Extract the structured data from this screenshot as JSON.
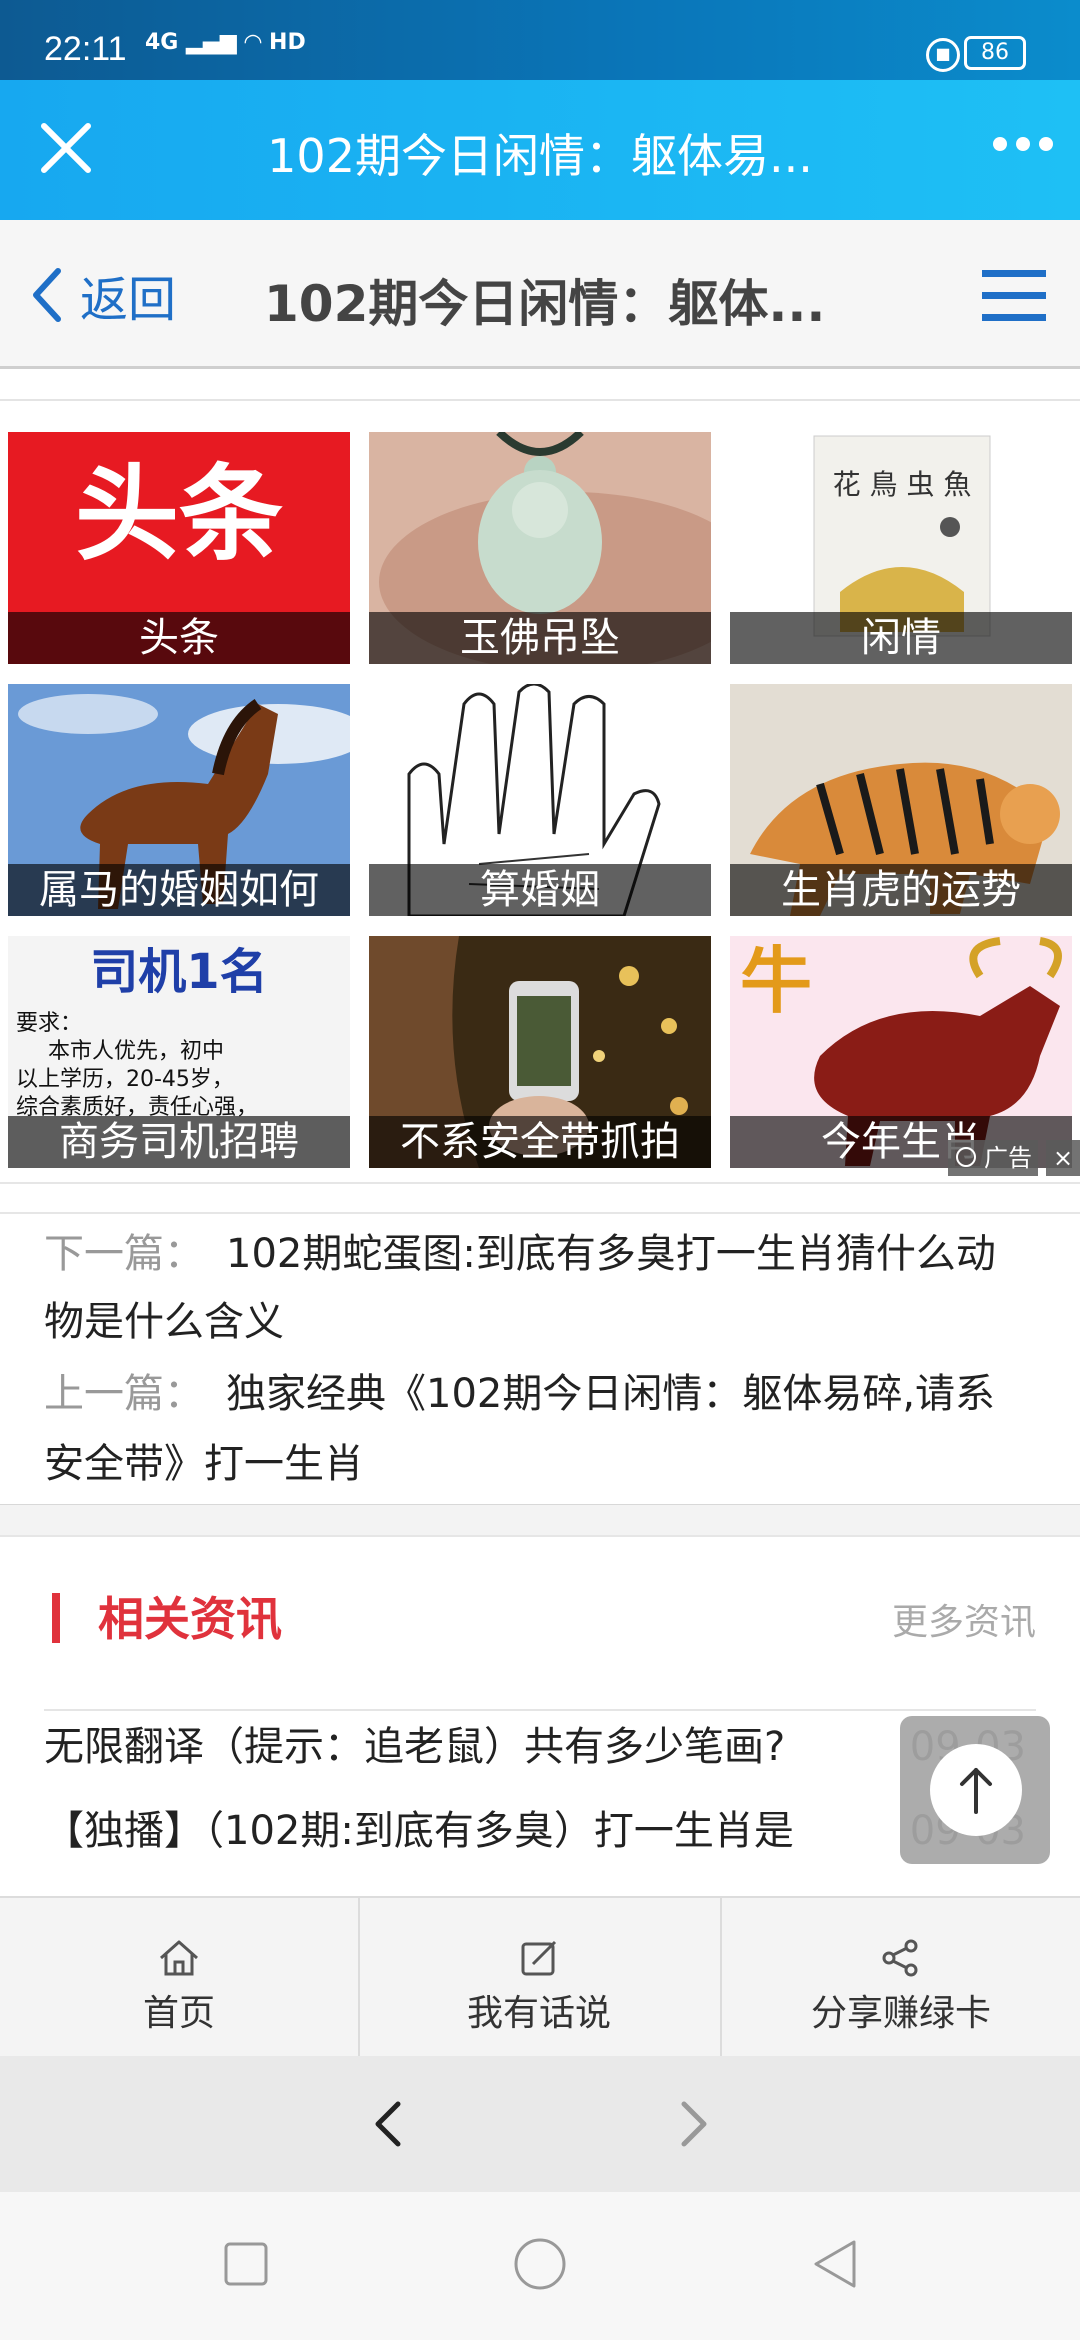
{
  "status_bar": {
    "time": "22:11",
    "signal": "4G",
    "network": "HD",
    "battery": "86"
  },
  "app_bar": {
    "title": "102期今日闲情：躯体易..."
  },
  "page_header": {
    "back_label": "返回",
    "title": "102期今日闲情：躯体..."
  },
  "grid": [
    {
      "caption": "头条",
      "banner": "头条"
    },
    {
      "caption": "玉佛吊坠"
    },
    {
      "caption": "闲情",
      "book_title": "花 鳥 虫 魚"
    },
    {
      "caption": "属马的婚姻如何"
    },
    {
      "caption": "算婚姻"
    },
    {
      "caption": "生肖虎的运势"
    },
    {
      "caption": "商务司机招聘",
      "poster_title": "司机1名",
      "poster_body": [
        "要求：",
        "本市人优先，初中",
        "以上学历，20-45岁，",
        "综合素质好，责任心强，"
      ]
    },
    {
      "caption": "不系安全带抓拍"
    },
    {
      "caption": "今年生肖"
    }
  ],
  "ad": {
    "label": "广告",
    "close": "×"
  },
  "article_nav": {
    "next_key": "下一篇：",
    "next_line1": "102期蛇蛋图:到底有多臭打一生肖猜什么动",
    "next_line2": "物是什么含义",
    "prev_key": "上一篇：",
    "prev_line1": "独家经典《102期今日闲情：躯体易碎,请系",
    "prev_line2": "安全带》打一生肖"
  },
  "related": {
    "title": "相关资讯",
    "more": "更多资讯",
    "items": [
      {
        "title": "无限翻译（提示：追老鼠）共有多少笔画?",
        "date": "09-03"
      },
      {
        "title": "【独播】（102期:到底有多臭）打一生肖是",
        "date": "09-03"
      }
    ]
  },
  "toolbar": {
    "home": "首页",
    "comment": "我有话说",
    "share": "分享赚绿卡"
  }
}
